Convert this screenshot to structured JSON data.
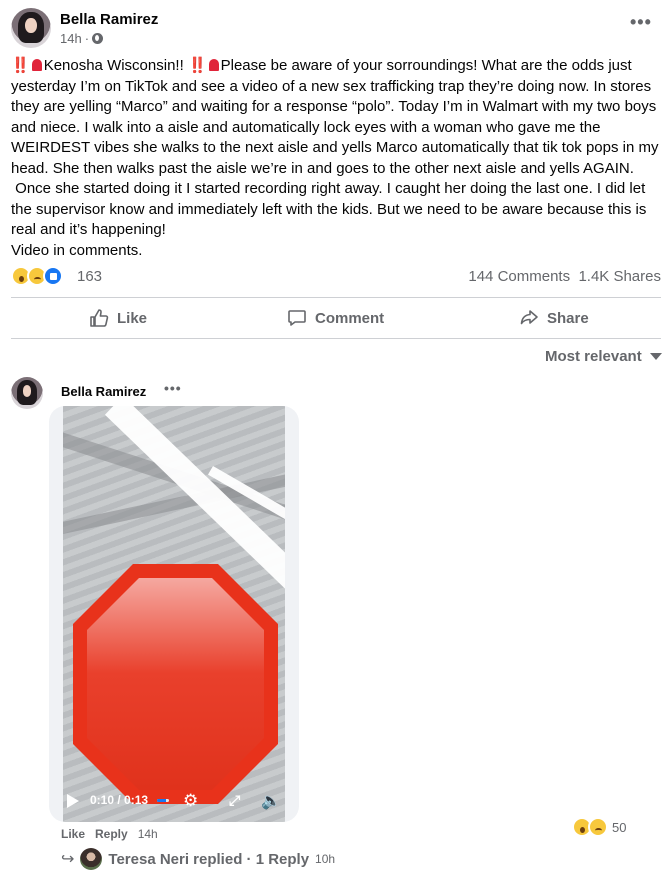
{
  "post": {
    "author": "Bella Ramirez",
    "time": "14h",
    "more_label": "•••",
    "text_prefix_bang": "‼️",
    "text_line1": "Kenosha Wisconsin!! ",
    "text_after_sirens": "Please be aware of your sorroundings! What are the odds just yesterday I’m on TikTok and see a video of a new sex trafficking trap they’re doing now. In stores they are yelling “Marco” and waiting for a response “polo”. Today I’m in Walmart with my two boys and niece. I walk into a aisle and automatically lock eyes with a woman who gave me the WEIRDEST vibes she walks to the next aisle and yells Marco automatically that tik tok pops in my head. She then walks past the aisle we’re in and goes to the other next aisle and yells AGAIN.\n Once she started doing it I started recording right away. I caught her doing the last one. I did let the supervisor know and immediately left with the kids. But we need to be aware because this is real and it’s happening!\nVideo in comments.",
    "reaction_count": "163",
    "comments_count": "144 Comments",
    "shares_count": "1.4K Shares",
    "reactions": [
      "wow",
      "sad",
      "like"
    ]
  },
  "actions": {
    "like": "Like",
    "comment": "Comment",
    "share": "Share"
  },
  "sort_label": "Most relevant",
  "comment": {
    "author": "Bella Ramirez",
    "more_label": "•••",
    "like": "Like",
    "reply": "Reply",
    "time": "14h",
    "reaction_count": "50",
    "reactions": [
      "wow",
      "sad"
    ],
    "video": {
      "time_display": "0:10 / 0:13",
      "progress_fraction": 0.77
    }
  },
  "reply_summary": {
    "text": "Teresa Neri replied · 1 Reply",
    "time": "10h"
  },
  "colors": {
    "accent": "#1877f2",
    "muted_text": "#65676b",
    "stop_red": "#e0321c"
  }
}
